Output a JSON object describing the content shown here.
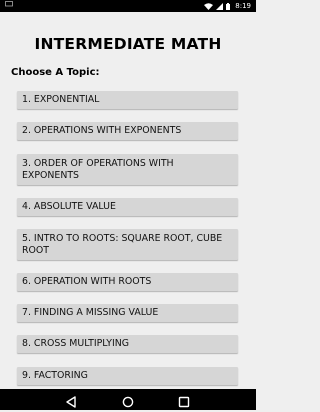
{
  "status_bar": {
    "left_icon": "tv-cast-icon",
    "time": "8:19"
  },
  "page": {
    "title": "INTERMEDIATE MATH",
    "section_label": "Choose A Topic:"
  },
  "topics": [
    "1. EXPONENTIAL",
    "2. OPERATIONS WITH EXPONENTS",
    "3. ORDER OF OPERATIONS WITH EXPONENTS",
    "4. ABSOLUTE VALUE",
    "5. INTRO TO ROOTS: SQUARE ROOT, CUBE ROOT",
    "6. OPERATION WITH ROOTS",
    "7. FINDING A MISSING VALUE",
    "8. CROSS MULTIPLYING",
    "9. FACTORING"
  ],
  "nav_bar": {
    "back_icon": "back-triangle-icon",
    "home_icon": "home-circle-icon",
    "recents_icon": "recents-square-icon"
  }
}
